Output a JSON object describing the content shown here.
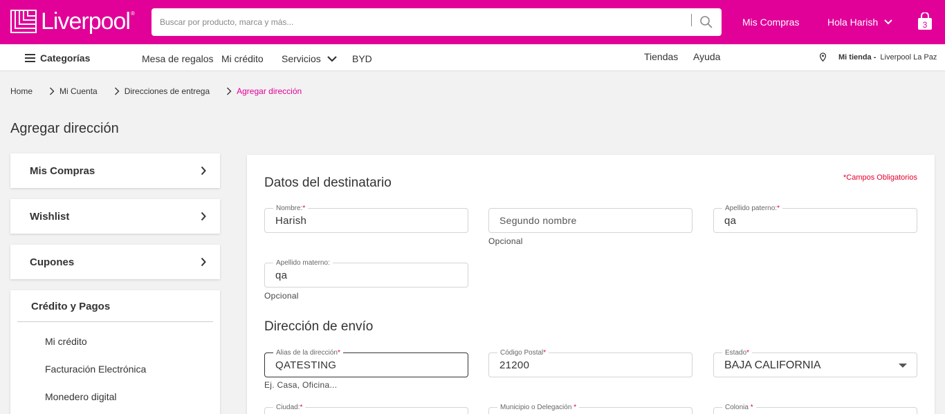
{
  "header": {
    "logo_text": "Liverpool",
    "logo_reg": "®",
    "search_placeholder": "Buscar por producto, marca y más...",
    "mis_compras": "Mis Compras",
    "greeting": "Hola Harish",
    "cart_count": "3"
  },
  "nav": {
    "categories": "Categorías",
    "items": [
      "Mesa de regalos",
      "Mi crédito",
      "Servicios",
      "BYD"
    ],
    "right_links": [
      "Tiendas",
      "Ayuda"
    ],
    "store_label": "Mi tienda -",
    "store_name": "Liverpool La Paz"
  },
  "breadcrumb": [
    "Home",
    "Mi Cuenta",
    "Direcciones de entrega",
    "Agregar dirección"
  ],
  "page_title": "Agregar dirección",
  "sidebar": {
    "cards": [
      "Mis Compras",
      "Wishlist",
      "Cupones"
    ],
    "credit_title": "Crédito y Pagos",
    "credit_items": [
      "Mi crédito",
      "Facturación Electrónica",
      "Monedero digital"
    ]
  },
  "form": {
    "required_note": "*Campos Obligatorios",
    "section1_title": "Datos del destinatario",
    "section2_title": "Dirección de envío",
    "nombre": {
      "label": "Nombre:",
      "value": "Harish"
    },
    "segundo_nombre": {
      "placeholder": "Segundo nombre",
      "helper": "Opcional"
    },
    "apellido_paterno": {
      "label": "Apellido paterno:",
      "value": "qa"
    },
    "apellido_materno": {
      "label": "Apellido materno:",
      "value": "qa",
      "helper": "Opcional"
    },
    "alias": {
      "label": "Alias de la dirección",
      "value": "QATESTING",
      "helper": "Ej. Casa, Oficina..."
    },
    "codigo_postal": {
      "label": "Código Postal",
      "value": "21200"
    },
    "estado": {
      "label": "Estado",
      "value": "BAJA CALIFORNIA"
    },
    "ciudad": {
      "label": "Ciudad:"
    },
    "municipio": {
      "label": "Municipio o Delegación"
    },
    "colonia": {
      "label": "Colonia"
    },
    "req_mark": "*"
  },
  "colors": {
    "brand": "#e10098",
    "required": "#e4002b"
  }
}
